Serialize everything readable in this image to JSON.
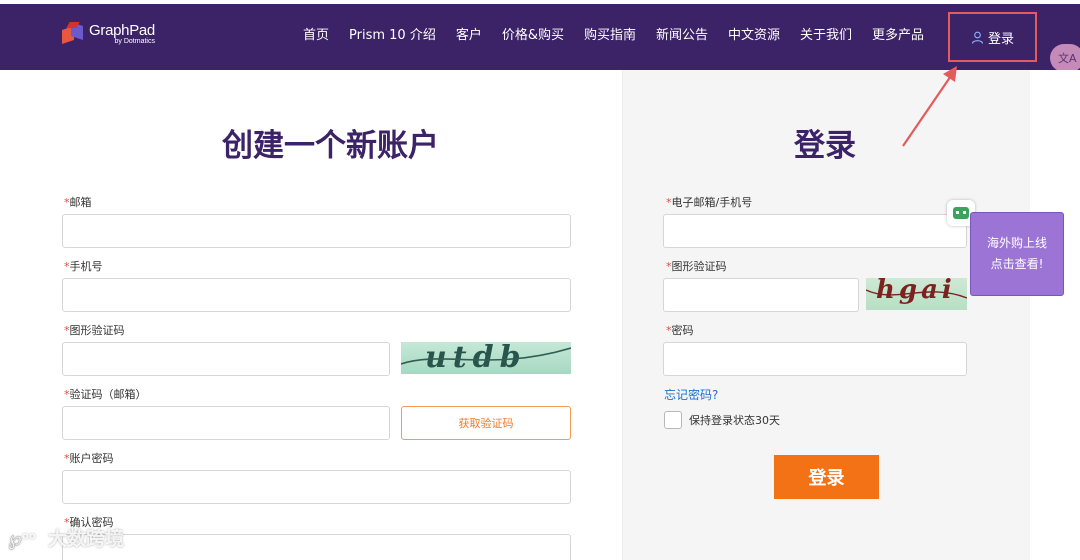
{
  "header": {
    "logo_name": "GraphPad",
    "logo_sub": "by Dotmatics",
    "nav": [
      "首页",
      "Prism 10 介绍",
      "客户",
      "价格&购买",
      "购买指南",
      "新闻公告",
      "中文资源",
      "关于我们",
      "更多产品"
    ],
    "login_label": "登录",
    "translate_label": "文A"
  },
  "register": {
    "title": "创建一个新账户",
    "required_mark": "*",
    "email_label": "邮箱",
    "phone_label": "手机号",
    "captcha_label": "图形验证码",
    "captcha_text": "utdb",
    "code_label": "验证码（邮箱）",
    "get_code_label": "获取验证码",
    "password_label": "账户密码",
    "confirm_label": "确认密码"
  },
  "login": {
    "title": "登录",
    "account_label": "电子邮箱/手机号",
    "captcha_label": "图形验证码",
    "captcha_text": "hgai",
    "password_label": "密码",
    "forgot_label": "忘记密码?",
    "remember_label": "保持登录状态30天",
    "submit_label": "登录"
  },
  "promo": {
    "line1": "海外购上线",
    "line2": "点击查看!"
  },
  "watermark": "大数跨境",
  "colors": {
    "header_bg": "#3c2266",
    "accent_orange": "#f47216",
    "title_purple": "#3c2266",
    "highlight_red": "#e35b5b",
    "link_blue": "#1f6fd1",
    "promo_bg": "#9b74d6"
  }
}
